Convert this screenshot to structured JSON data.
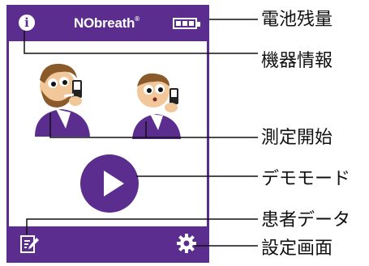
{
  "header": {
    "app_name": "NObreath",
    "registered_mark": "®",
    "info_glyph": "i",
    "info_icon": "info-icon",
    "battery_icon": "battery-icon",
    "battery_level": 1.0
  },
  "main": {
    "adult_icon": "bearded-man-measuring-icon",
    "child_icon": "boy-measuring-icon",
    "play_icon": "play-icon"
  },
  "footer": {
    "patient_icon": "edit-document-icon",
    "settings_icon": "gear-icon"
  },
  "callouts": {
    "battery": "電池残量",
    "device_info": "機器情報",
    "start_measurement": "測定開始",
    "demo_mode": "デモモード",
    "patient_data": "患者データ",
    "settings": "設定画面"
  },
  "colors": {
    "brand_purple": "#5b2d8e",
    "skin": "#f2c89a",
    "hair": "#8a5a2b",
    "device": "#222222"
  }
}
